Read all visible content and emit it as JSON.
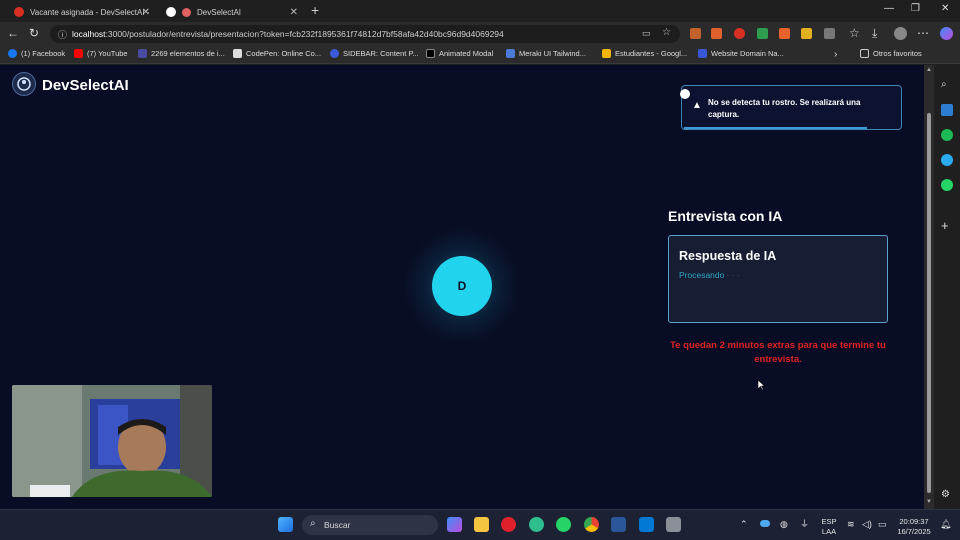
{
  "browser": {
    "tabs": [
      {
        "label": "Vacante asignada - DevSelectAI -",
        "active": false,
        "color": "#d93025"
      },
      {
        "label": "DevSelectAI",
        "active": true,
        "color": "#e06060"
      }
    ],
    "url_host": "localhost",
    "url_rest": ":3000/postulador/entrevista/presentacion?token=fcb232f1895361f74812d7bf58afa42d40bc96d9d4069294",
    "bookmarks": [
      {
        "label": "(1) Facebook",
        "color": "#1877f2"
      },
      {
        "label": "(7) YouTube",
        "color": "#ff0000"
      },
      {
        "label": "2269 elementos de i...",
        "color": "#4a4aa0"
      },
      {
        "label": "CodePen: Online Co...",
        "color": "#dddddd"
      },
      {
        "label": "SIDEBAR: Content P...",
        "color": "#3b5bdb"
      },
      {
        "label": "Animated Modal",
        "color": "#000000"
      },
      {
        "label": "Meraki UI Tailwind...",
        "color": "#4a7bd9"
      },
      {
        "label": "Estudiantes - Googl...",
        "color": "#f4b400"
      },
      {
        "label": "Website Domain Na...",
        "color": "#3a56d4"
      }
    ],
    "other_bookmarks": "Otros favoritos"
  },
  "app": {
    "brand": "DevSelectAI",
    "avatar_letter": "D",
    "interview_title": "Entrevista con IA",
    "response_title": "Respuesta de IA",
    "response_status": "Procesando",
    "response_dots": "· · ·",
    "timer_message": "Te quedan 2 minutos extras para que termine tu entrevista.",
    "toast": {
      "message": "No se detecta tu rostro. Se realizará una captura.",
      "icon": "warning-icon",
      "progress": 0.85
    }
  },
  "taskbar": {
    "search_label": "Buscar",
    "lang_top": "ESP",
    "lang_bottom": "LAA",
    "time": "20:09:37",
    "date": "16/7/2025"
  },
  "colors": {
    "page_bg": "#080c24",
    "accent": "#22d3ee",
    "warning_text": "#e02424"
  }
}
